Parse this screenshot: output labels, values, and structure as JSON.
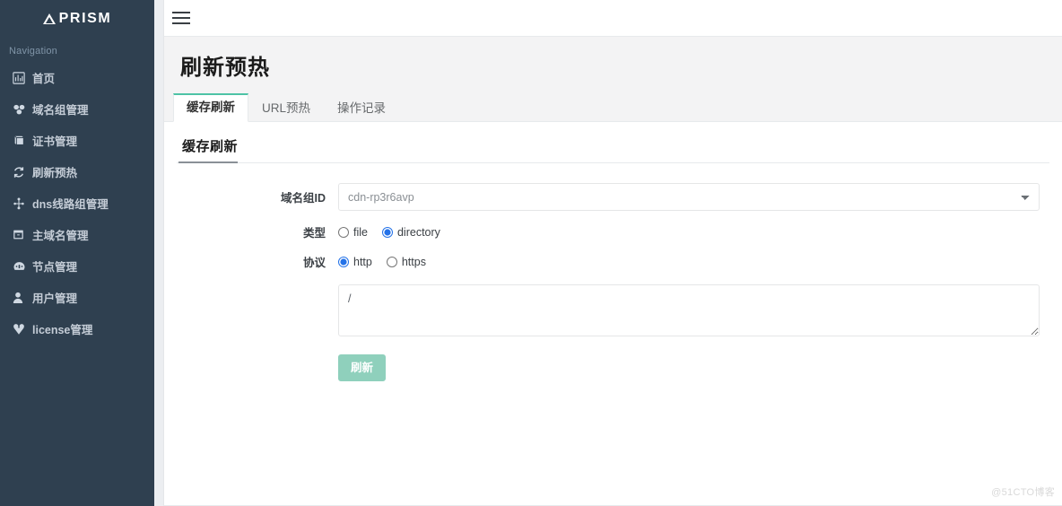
{
  "sidebar": {
    "brand": "PRISM",
    "brand_icon": "triangle-icon",
    "nav_header": "Navigation",
    "items": [
      {
        "label": "首页",
        "icon": "chart-bar-icon"
      },
      {
        "label": "域名组管理",
        "icon": "cubes-icon"
      },
      {
        "label": "证书管理",
        "icon": "book-icon"
      },
      {
        "label": "刷新预热",
        "icon": "refresh-sync-icon"
      },
      {
        "label": "dns线路组管理",
        "icon": "sitemap-icon"
      },
      {
        "label": "主域名管理",
        "icon": "window-icon"
      },
      {
        "label": "节点管理",
        "icon": "dashboard-icon"
      },
      {
        "label": "用户管理",
        "icon": "user-icon"
      },
      {
        "label": "license管理",
        "icon": "puzzle-icon"
      }
    ]
  },
  "topbar": {
    "menu_toggle_icon": "hamburger-icon"
  },
  "page": {
    "title": "刷新预热",
    "tabs": [
      {
        "label": "缓存刷新",
        "active": true
      },
      {
        "label": "URL预热",
        "active": false
      },
      {
        "label": "操作记录",
        "active": false
      }
    ]
  },
  "panel": {
    "title": "缓存刷新",
    "fields": {
      "domain_group": {
        "label": "域名组ID",
        "value": "cdn-rp3r6avp",
        "options": [
          "cdn-rp3r6avp"
        ]
      },
      "type": {
        "label": "类型",
        "options": [
          {
            "label": "file",
            "checked": false
          },
          {
            "label": "directory",
            "checked": true
          }
        ]
      },
      "protocol": {
        "label": "协议",
        "options": [
          {
            "label": "http",
            "checked": true
          },
          {
            "label": "https",
            "checked": false
          }
        ]
      },
      "urls": {
        "value": "/",
        "placeholder": ""
      }
    },
    "submit_label": "刷新"
  },
  "watermark": "@51CTO博客",
  "colors": {
    "sidebar_bg": "#2f4050",
    "accent_teal": "#4ec3a6",
    "button_bg": "#8fd0bc",
    "radio_blue": "#2472e8",
    "page_head_bg": "#f3f3f4"
  }
}
